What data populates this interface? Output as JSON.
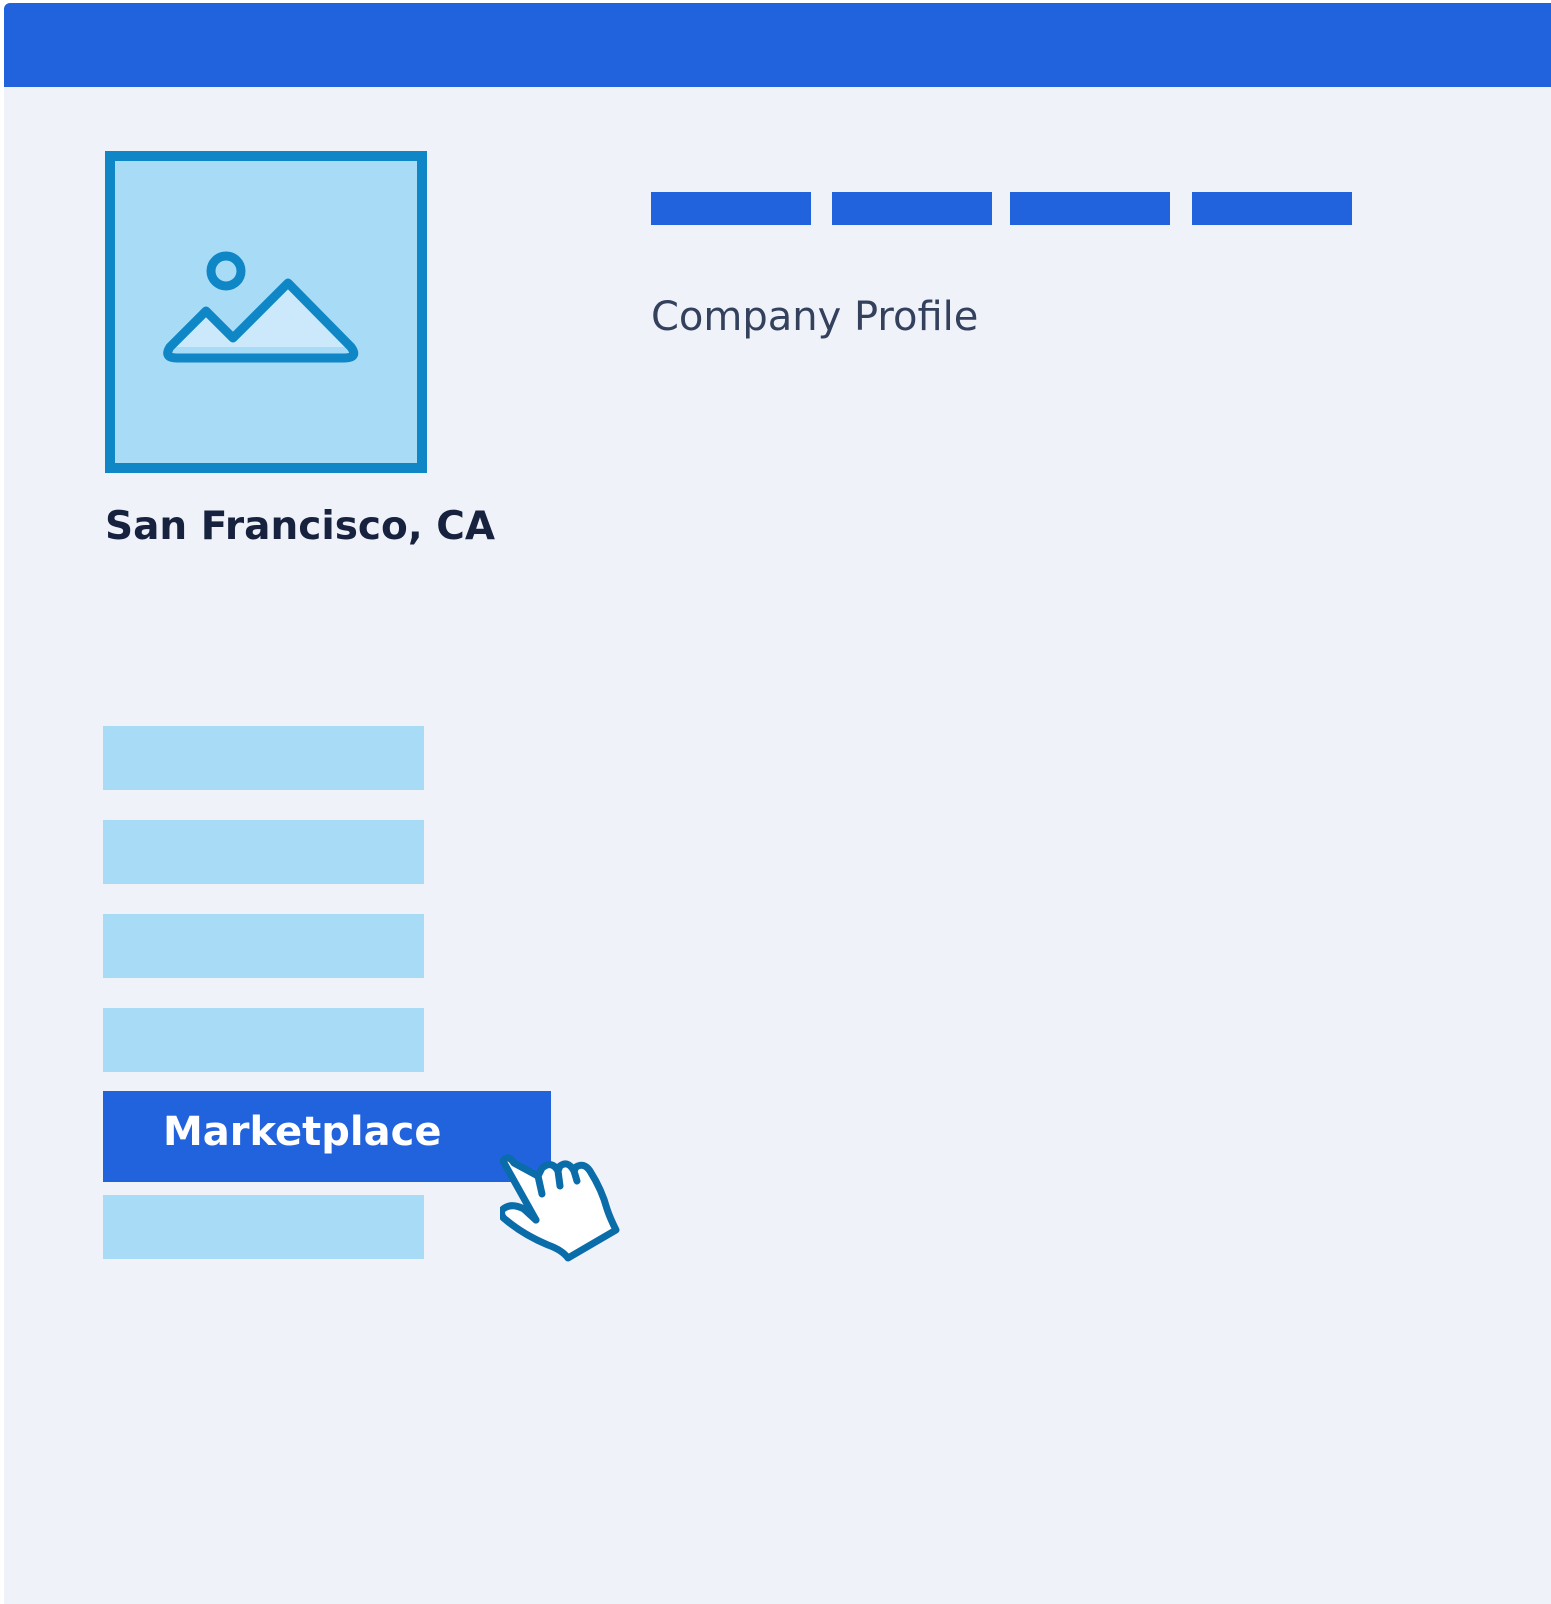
{
  "header": {
    "color": "#2163dd"
  },
  "profile": {
    "logo_icon": "image-icon",
    "location": "San Francisco, CA"
  },
  "nav": {
    "tab_count": 4
  },
  "main": {
    "title": "Company Profile"
  },
  "sidebar": {
    "active_item_label": "Marketplace",
    "placeholder_items_above": 4,
    "placeholder_items_below": 1
  },
  "cursor": {
    "icon": "pointer-hand-icon"
  },
  "colors": {
    "primary": "#2163dd",
    "light_blue": "#a8dcf6",
    "icon_blue": "#0f86c6",
    "background": "#f0f2fa",
    "text_dark": "#17223f",
    "text_muted": "#33415d"
  }
}
